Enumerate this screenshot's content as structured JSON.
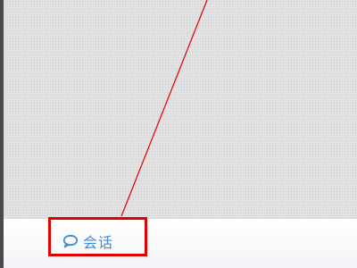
{
  "bottom_tab": {
    "label": "会话",
    "icon": "chat-bubble-icon",
    "color": "#3b8ed6"
  },
  "annotation": {
    "color": "#e00000"
  }
}
